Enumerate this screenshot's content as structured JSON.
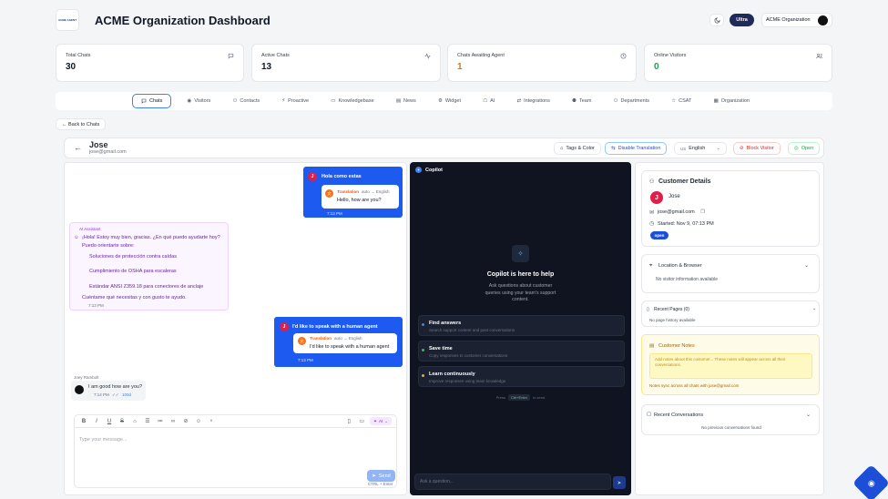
{
  "header": {
    "logo_text": "ACME AGENT",
    "title": "ACME Organization Dashboard",
    "plan_badge": "Ultra",
    "org_name": "ACME Organization"
  },
  "stats": [
    {
      "label": "Total Chats",
      "value": "30",
      "color": "#111827"
    },
    {
      "label": "Active Chats",
      "value": "13",
      "color": "#111827"
    },
    {
      "label": "Chats Awaiting Agent",
      "value": "1",
      "color": "#d97706"
    },
    {
      "label": "Online Visitors",
      "value": "0",
      "color": "#16a34a"
    }
  ],
  "tabs": [
    "Chats",
    "Visitors",
    "Contacts",
    "Proactive",
    "Knowledgebase",
    "News",
    "Widget",
    "AI",
    "Integrations",
    "Team",
    "Departments",
    "CSAT",
    "Organization"
  ],
  "back_label": "← Back to Chats",
  "chat_header": {
    "name": "Jose",
    "email": "jose@gmail.com",
    "tags_label": "Tags & Color",
    "disable_translation": "Disable Translation",
    "lang_code": "US",
    "lang_label": "English",
    "block_label": "Block Visitor",
    "open_label": "Open"
  },
  "messages": {
    "m1_text": "Hola como estas",
    "m1_trans_label": "Translation",
    "m1_trans_dir": "auto → English",
    "m1_trans_text": "Hello, how are you?",
    "m1_time": "7:13 PM",
    "ai_label": "AI Assistant",
    "ai_line1": "¡Hola! Estoy muy bien, gracias. ¿En qué puedo ayudarte hoy?",
    "ai_line2": "Puedo orientarte sobre:",
    "ai_item1": "Soluciones de protección contra caídas",
    "ai_item2": "Cumplimiento de OSHA para escaleras",
    "ai_item3": "Estándar ANSI Z359.18 para conectores de anclaje",
    "ai_line3": "Cuéntame qué necesitas y con gusto te ayudo.",
    "ai_time": "7:13 PM",
    "m2_text": "I'd like to speak with a human agent",
    "m2_trans_label": "Translation",
    "m2_trans_dir": "auto → English",
    "m2_trans_text": "I'd like to speak with a human agent",
    "m2_time": "7:13 PM",
    "agent_name": "Joey Rambolt",
    "agent_text": "I am good how are you?",
    "agent_time": "7:14 PM",
    "agent_status": "100d"
  },
  "composer": {
    "placeholder": "Type your message...",
    "ai_label": "AI",
    "send_label": "Send",
    "hint": "CTRL + Enter"
  },
  "copilot": {
    "title": "Copilot",
    "heading": "Copilot is here to help",
    "desc": "Ask questions about customer queries using your team's support content.",
    "items": [
      {
        "title": "Find answers",
        "desc": "Search support content and past conversations",
        "color": "#3b82f6"
      },
      {
        "title": "Save time",
        "desc": "Copy responses to customer conversations",
        "color": "#22c55e"
      },
      {
        "title": "Learn continuously",
        "desc": "Improve responses using team knowledge",
        "color": "#eab308"
      }
    ],
    "hint_pre": "Press",
    "hint_key": "Ctrl+Enter",
    "hint_post": "to send",
    "placeholder": "Ask a question..."
  },
  "details": {
    "title": "Customer Details",
    "initial": "J",
    "name": "Jose",
    "email": "jose@gmail.com",
    "started": "Started: Nov 9, 07:13 PM",
    "status": "open",
    "location_title": "Location & Browser",
    "location_empty": "No visitor information available",
    "pages_title": "Recent Pages (0)",
    "pages_empty": "No page history available",
    "notes_title": "Customer Notes",
    "notes_placeholder": "Add notes about this customer... These notes will appear across all their conversations.",
    "notes_sync": "Notes sync across all chats with jose@gmail.com",
    "convos_title": "Recent Conversations",
    "convos_empty": "No previous conversations found"
  }
}
